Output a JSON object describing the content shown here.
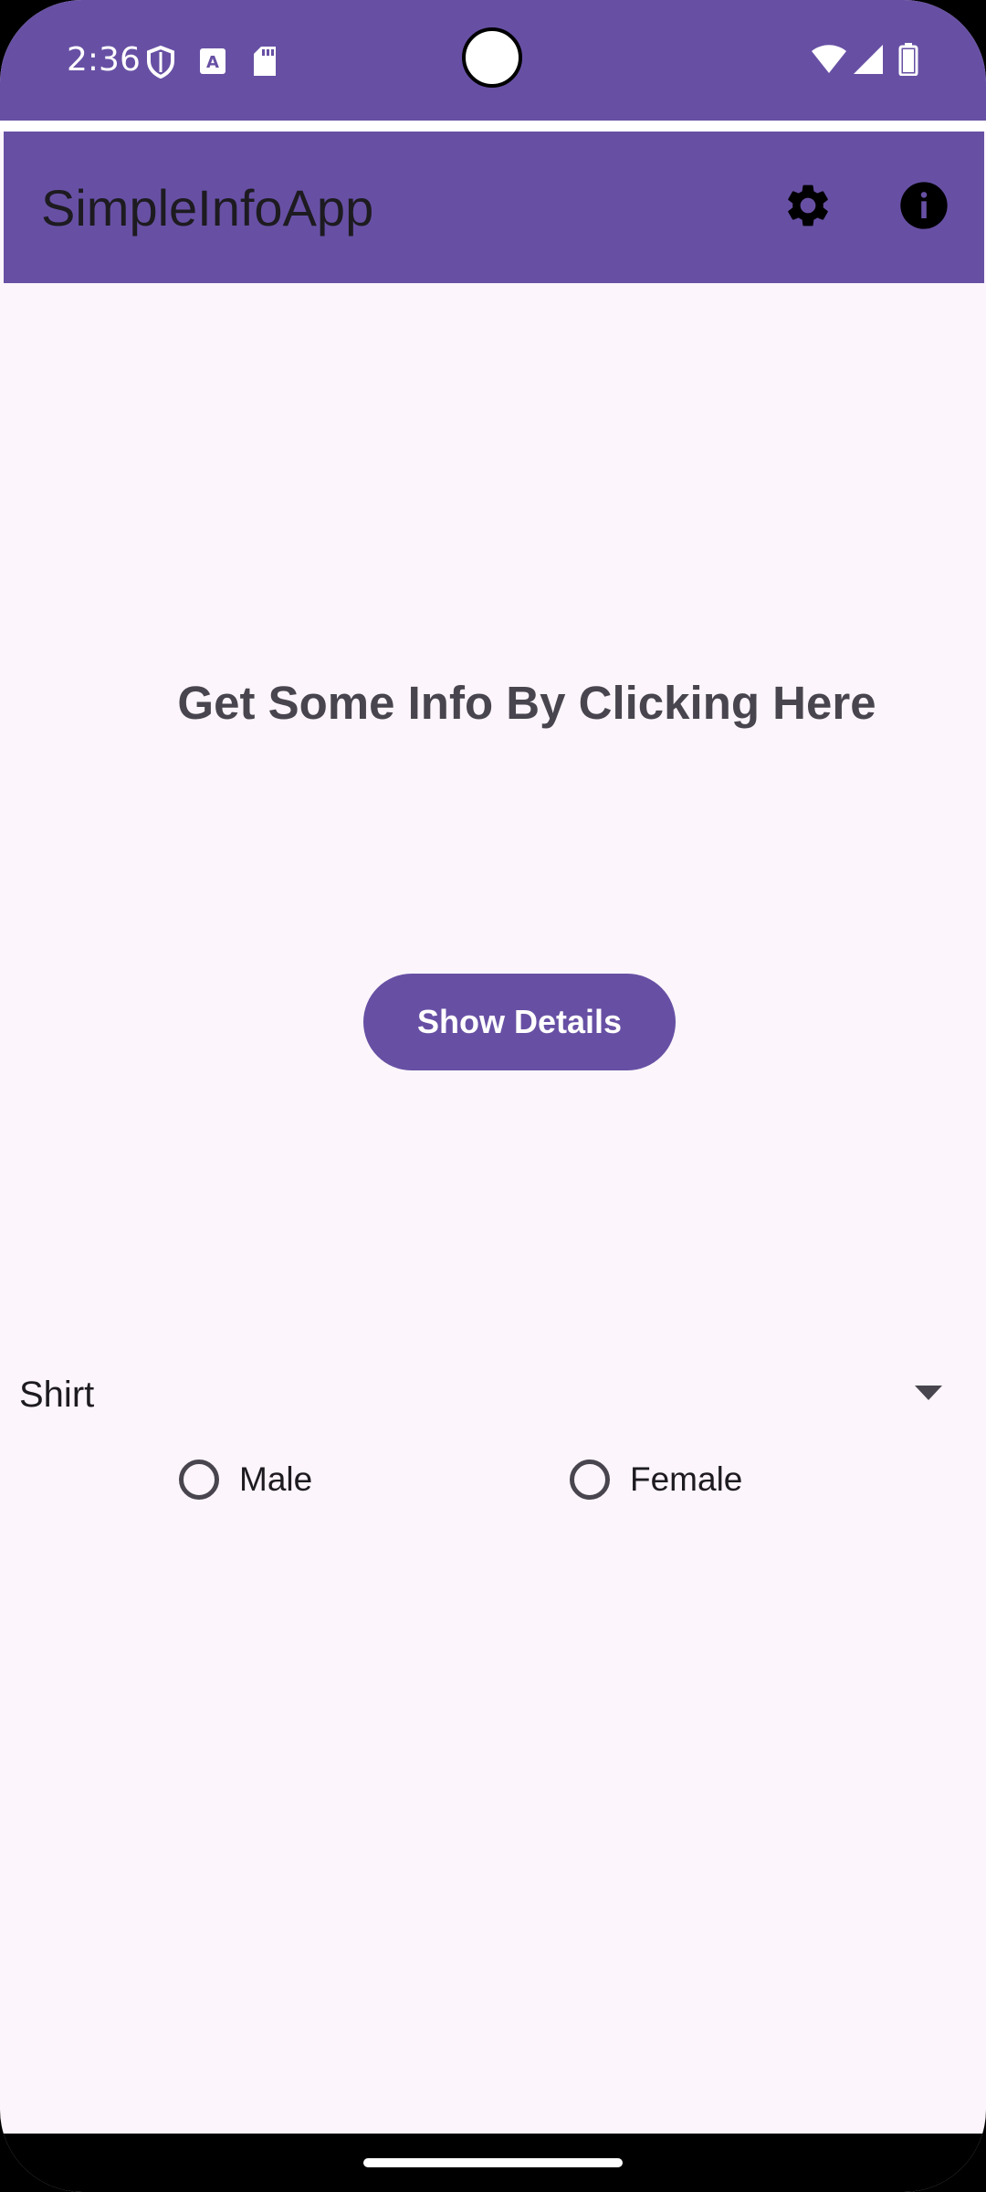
{
  "status_bar": {
    "time": "2:36",
    "left_icons": [
      "shield-icon",
      "keyboard-a-icon",
      "sd-card-icon"
    ],
    "right_icons": [
      "wifi-icon",
      "signal-icon",
      "battery-icon"
    ]
  },
  "app_bar": {
    "title": "SimpleInfoApp",
    "actions": [
      {
        "icon": "settings-gear-icon"
      },
      {
        "icon": "info-icon"
      }
    ]
  },
  "main": {
    "headline": "Get Some Info By Clicking Here",
    "button_label": "Show Details",
    "spinner": {
      "selected_value": "Shirt",
      "icon": "dropdown-arrow-icon"
    },
    "radio_options": [
      {
        "label": "Male",
        "checked": false
      },
      {
        "label": "Female",
        "checked": false
      }
    ]
  },
  "colors": {
    "primary": "#6750a4",
    "background": "#fcf5fb",
    "on_surface": "#1d1b20",
    "on_surface_variant": "#49454f",
    "on_primary": "#ffffff"
  }
}
